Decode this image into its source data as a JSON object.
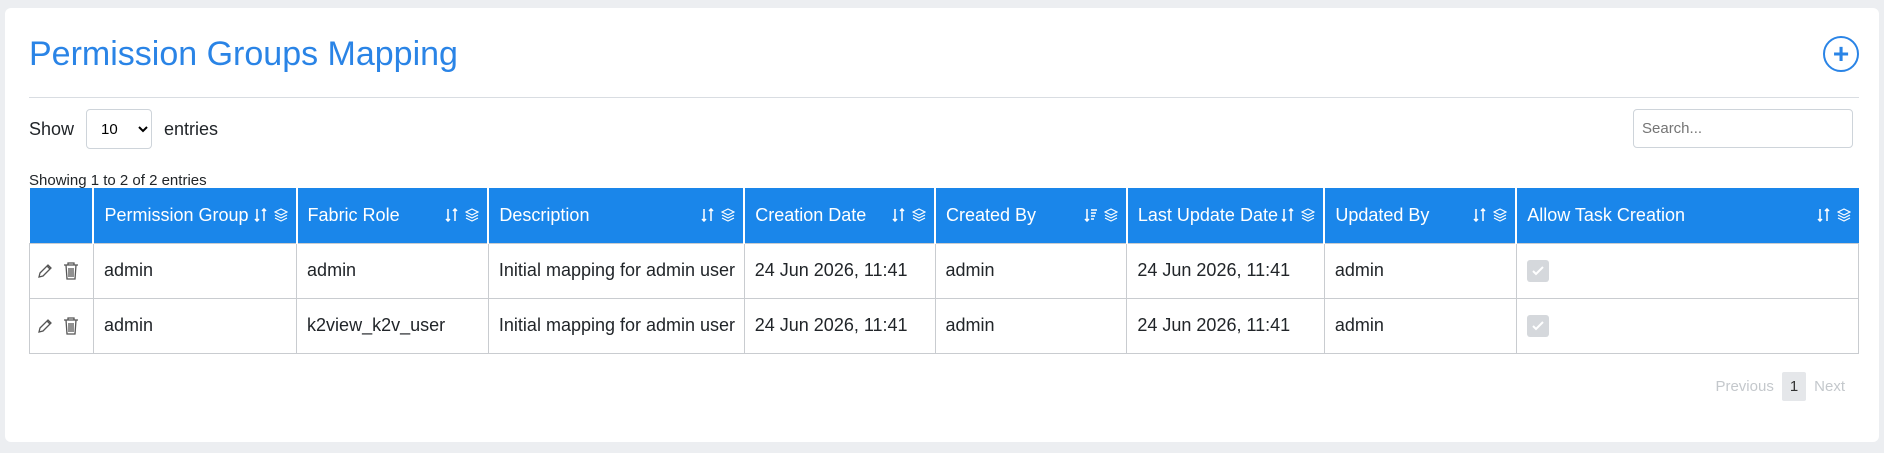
{
  "header": {
    "title": "Permission Groups Mapping",
    "add_label": "+"
  },
  "length": {
    "show_label": "Show",
    "entries_label": "entries",
    "selected": "10",
    "options": [
      "10"
    ]
  },
  "search": {
    "placeholder": "Search..."
  },
  "info": "Showing 1 to 2 of 2 entries",
  "table": {
    "columns": [
      "",
      "Permission Group",
      "Fabric Role",
      "Description",
      "Creation Date",
      "Created By",
      "Last Update Date",
      "Updated By",
      "Allow Task Creation"
    ],
    "rows": [
      {
        "permission_group": "admin",
        "fabric_role": "admin",
        "description": "Initial mapping for admin user",
        "creation_date": "24 Jun 2026, 11:41",
        "created_by": "admin",
        "last_update_date": "24 Jun 2026, 11:41",
        "updated_by": "admin",
        "allow_task_creation": true
      },
      {
        "permission_group": "admin",
        "fabric_role": "k2view_k2v_user",
        "description": "Initial mapping for admin user",
        "creation_date": "24 Jun 2026, 11:41",
        "created_by": "admin",
        "last_update_date": "24 Jun 2026, 11:41",
        "updated_by": "admin",
        "allow_task_creation": true
      }
    ]
  },
  "pagination": {
    "previous": "Previous",
    "current": "1",
    "next": "Next"
  },
  "colors": {
    "accent": "#1a86ea",
    "title": "#2a84e6"
  },
  "icons": [
    "plus-circle-icon",
    "sort-icon",
    "layers-icon",
    "pencil-icon",
    "trash-icon",
    "check-icon"
  ]
}
